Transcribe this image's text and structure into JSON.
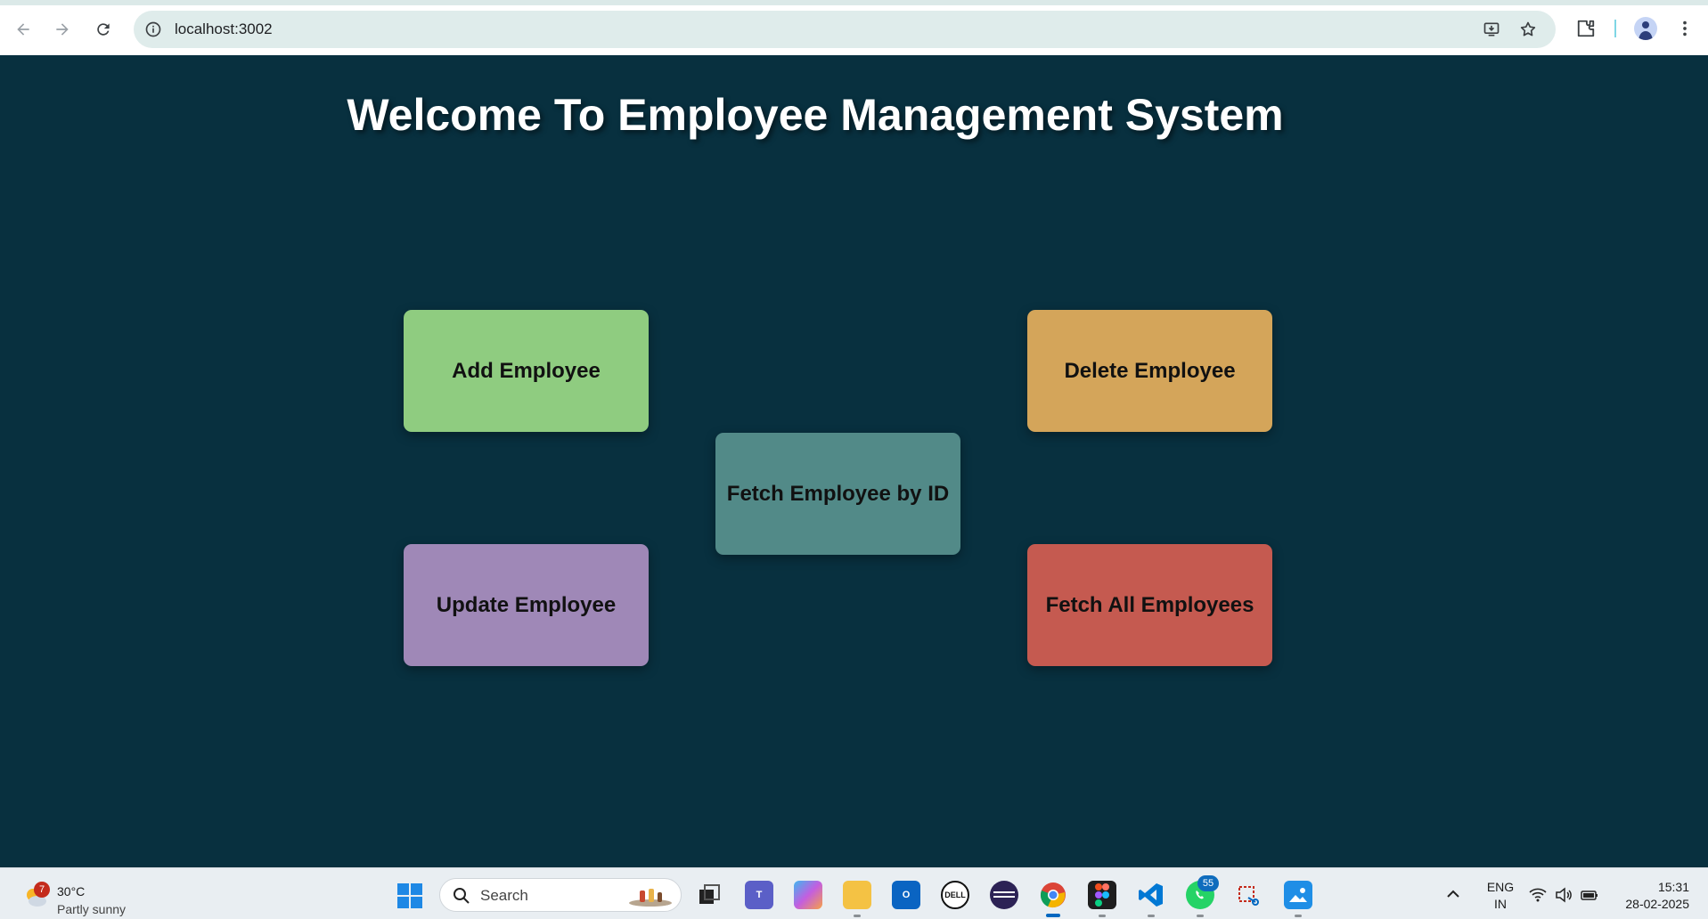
{
  "browser": {
    "url": "localhost:3002"
  },
  "page": {
    "title": "Welcome To Employee Management System",
    "buttons": {
      "add": "Add Employee",
      "delete": "Delete Employee",
      "fetch_by_id": "Fetch Employee by ID",
      "update": "Update Employee",
      "fetch_all": "Fetch All Employees"
    },
    "colors": {
      "background": "#08303f",
      "add": "#8fcc80",
      "delete": "#d4a55a",
      "fetch_by_id": "#528a88",
      "update": "#9f88b7",
      "fetch_all": "#c55a50"
    }
  },
  "taskbar": {
    "weather": {
      "temp": "30°C",
      "desc": "Partly sunny",
      "badge": "7"
    },
    "search_placeholder": "Search",
    "apps": [
      "task-view",
      "teams",
      "copilot",
      "file-explorer",
      "outlook",
      "dell",
      "eclipse",
      "chrome",
      "figma",
      "vscode",
      "whatsapp",
      "snipping-tool",
      "photos"
    ],
    "whatsapp_badge": "55",
    "tray": {
      "lang_line1": "ENG",
      "lang_line2": "IN"
    },
    "clock": {
      "time": "15:31",
      "date": "28-02-2025"
    }
  }
}
